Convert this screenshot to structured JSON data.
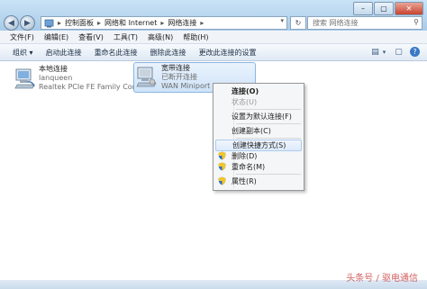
{
  "window": {
    "controls": {
      "minimize": "–",
      "maximize": "▢",
      "close": "✕"
    }
  },
  "address": {
    "crumbs": [
      "控制面板",
      "网络和 Internet",
      "网络连接"
    ],
    "separator": "▸"
  },
  "search": {
    "placeholder": "搜索 网络连接"
  },
  "menubar": {
    "items": [
      "文件(F)",
      "编辑(E)",
      "查看(V)",
      "工具(T)",
      "高级(N)",
      "帮助(H)"
    ]
  },
  "commandbar": {
    "items": [
      "组织 ▾",
      "启动此连接",
      "重命名此连接",
      "删除此连接",
      "更改此连接的设置"
    ]
  },
  "connections": [
    {
      "name": "本地连接",
      "status": "lanqueen",
      "device": "Realtek PCIe FE Family Control..."
    },
    {
      "name": "宽带连接",
      "status": "已断开连接",
      "device": "WAN Miniport (PPPOE)"
    }
  ],
  "context_menu": {
    "items": [
      {
        "label": "连接(O)",
        "style": "bold"
      },
      {
        "label": "状态(U)",
        "style": "disabled"
      },
      {
        "label": "设置为默认连接(F)",
        "style": "normal"
      },
      {
        "label": "创建副本(C)",
        "style": "normal"
      },
      {
        "label": "创建快捷方式(S)",
        "style": "hover"
      },
      {
        "label": "删除(D)",
        "style": "shield"
      },
      {
        "label": "重命名(M)",
        "style": "shield"
      },
      {
        "label": "属性(R)",
        "style": "shield"
      }
    ]
  },
  "watermark": "头条号 / 驱电通信",
  "colors": {
    "accent": "#8bb6e2",
    "titlebar": "#a9cbe7"
  }
}
